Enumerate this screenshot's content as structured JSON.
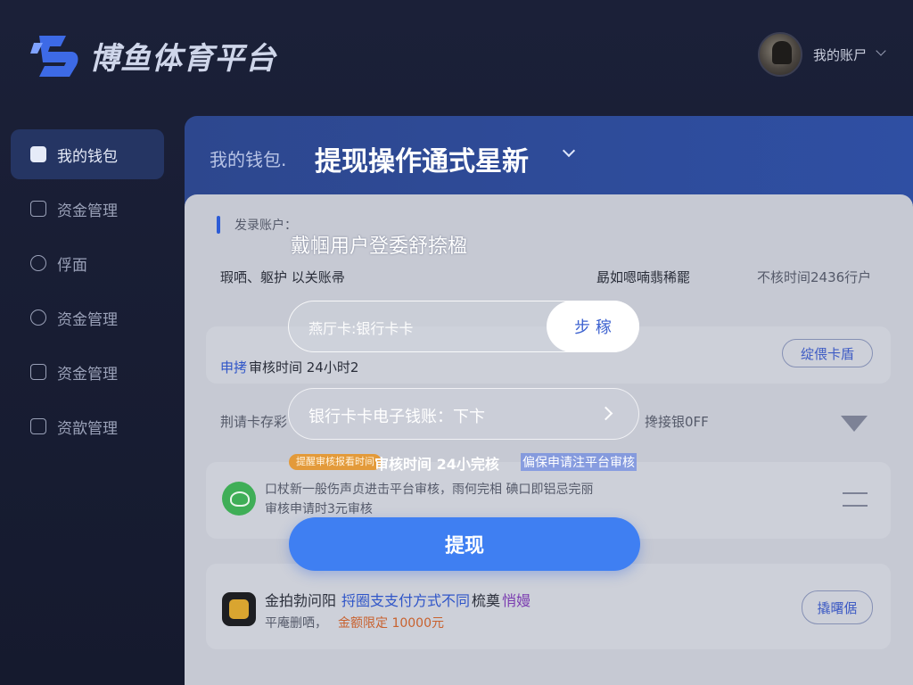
{
  "brand": {
    "name": "博鱼体育平台",
    "logo_icon": "lightning-b-logo-icon"
  },
  "account": {
    "label": "我的账尸",
    "avatar_icon": "user-avatar"
  },
  "sidebar": {
    "items": [
      {
        "label": "我的钱包",
        "icon": "wallet-icon",
        "active": true
      },
      {
        "label": "资金管理",
        "icon": "fund-icon",
        "active": false
      },
      {
        "label": "俘面",
        "icon": "info-circle-icon",
        "active": false
      },
      {
        "label": "资金管理",
        "icon": "upload-icon",
        "active": false
      },
      {
        "label": "资金管理",
        "icon": "card-icon",
        "active": false
      },
      {
        "label": "资歆管理",
        "icon": "document-icon",
        "active": false
      }
    ]
  },
  "header": {
    "small": "我的钱包.",
    "title": "提现操作通式星新"
  },
  "content": {
    "section_label": "发录账户：",
    "row1_left": "瑕哂、躯护 以关账帚",
    "row1_mid": "勗如嗯喃翡稀罷",
    "row1_right": "不核时间2436行户",
    "card1_left": "审核时间 24小时2",
    "card1_left_prefix": "申拷",
    "card1_btn": "绽偎卡盾",
    "row3_left": "荆请卡存彩",
    "row3_right": "搀接银0FF",
    "card2_line1": "口杖新一般伤声贞进击平台审核，雨何完相 碘口即铝忌完丽",
    "card2_line2": "审核申请时3元审核",
    "card3_line1_a": "金拍勃问阳",
    "card3_line1_b": "捋圈支支付方式不同",
    "card3_line1_c": "梳奠",
    "card3_line1_d": "悄嫚",
    "card3_line2_a": "平庵删哂，",
    "card3_line2_b": "金额限定 10000元",
    "card3_btn": "撬曙倨"
  },
  "dialog": {
    "title": "戴帼用户登委舒捺楹",
    "input_placeholder": "燕厅卡:银行卡卡",
    "step_button": "步 稼",
    "select_value": "银行卡卡电子钱账：下卞",
    "tag": "提醒审核报看时间",
    "review_text": "审核时间 24小完核",
    "highlight_text": "偏保申请注平台审核",
    "submit": "提现"
  },
  "colors": {
    "background": "#1b2038",
    "header_blue": "#2f4fa3",
    "sidebar_active": "#253563",
    "submit_blue": "#3f7ff2",
    "tag_orange": "#e39a3a"
  }
}
